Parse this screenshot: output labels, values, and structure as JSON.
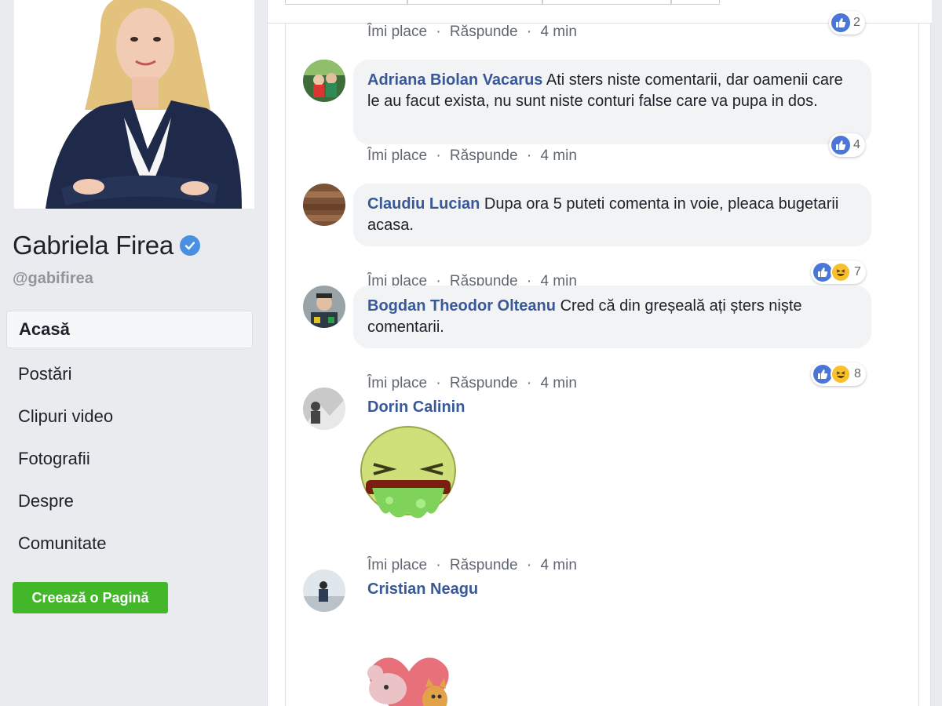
{
  "page": {
    "name": "Gabriela Firea",
    "handle": "@gabifirea",
    "nav": [
      "Acasă",
      "Postări",
      "Clipuri video",
      "Fotografii",
      "Despre",
      "Comunitate"
    ],
    "create_page_label": "Creează o Pagină"
  },
  "actions": {
    "like": "Îmi place",
    "reply": "Răspunde",
    "separator": "·",
    "time": "4 min"
  },
  "comments": [
    {
      "author": "",
      "text": "",
      "reaction_count": "2"
    },
    {
      "author": "Adriana Biolan Vacarus",
      "text": "Ati sters niste comentarii, dar oamenii care le au facut exista, nu sunt niste conturi false care va pupa in dos.",
      "reaction_count": "4"
    },
    {
      "author": "Claudiu Lucian",
      "text": "Dupa ora 5 puteti comenta in voie, pleaca bugetarii acasa.",
      "reaction_count": "7"
    },
    {
      "author": "Bogdan Theodor Olteanu",
      "text": "Cred că din greșeală ați șters niște comentarii.",
      "reaction_count": "8"
    },
    {
      "author": "Dorin Calinin",
      "text": "",
      "reaction_count": ""
    },
    {
      "author": "Cristian Neagu",
      "text": "",
      "reaction_count": ""
    }
  ],
  "colors": {
    "author_link": "#385898",
    "like_blue": "#4a76d8",
    "create_green": "#42b72a",
    "bubble_bg": "#f2f3f5"
  }
}
